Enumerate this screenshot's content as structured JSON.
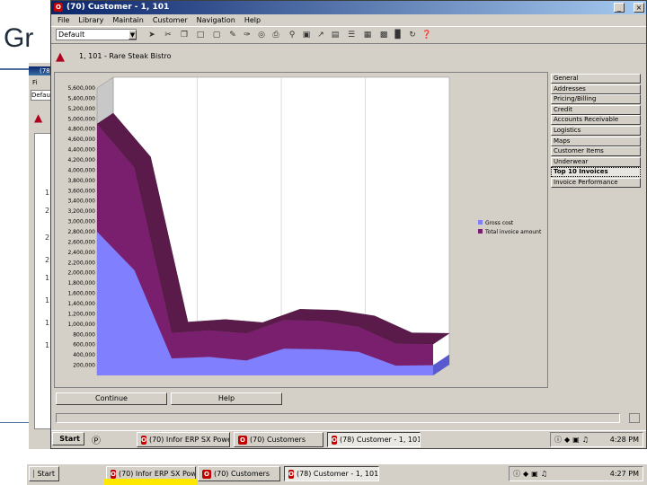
{
  "slide": {
    "title_fragment": "Gr"
  },
  "window": {
    "title": "(70) Customer - 1, 101",
    "icon": "app-red-square-icon",
    "menu": [
      "File",
      "Library",
      "Maintain",
      "Customer",
      "Navigation",
      "Help"
    ],
    "combo_value": "Default",
    "toolbar_icons": [
      "pointer-icon",
      "cut-icon",
      "copy-icon",
      "paste-icon",
      "new-icon",
      "edit-icon",
      "pen-icon",
      "preview-icon",
      "print-icon",
      "find-icon",
      "image-icon",
      "export-icon",
      "chart-icon",
      "tree-icon",
      "table-icon",
      "note-icon",
      "book-icon",
      "refresh-icon"
    ],
    "record_text": "1, 101 - Rare Steak Bistro"
  },
  "tabs": [
    {
      "label": "General",
      "selected": false
    },
    {
      "label": "Addresses",
      "selected": false
    },
    {
      "label": "Pricing/Billing",
      "selected": false
    },
    {
      "label": "Credit",
      "selected": false
    },
    {
      "label": "Accounts Receivable",
      "selected": false
    },
    {
      "label": "Logistics",
      "selected": false
    },
    {
      "label": "Maps",
      "selected": false
    },
    {
      "label": "Customer Items",
      "selected": false
    },
    {
      "label": "Underwear",
      "selected": false
    },
    {
      "label": "Top 10 Invoices",
      "selected": true
    },
    {
      "label": "Invoice Performance",
      "selected": false
    }
  ],
  "buttons": {
    "continue": "Continue",
    "help": "Help"
  },
  "chart_data": {
    "type": "area",
    "legend_position": "right",
    "grid": true,
    "ylim": [
      0,
      5600000
    ],
    "y_ticks": [
      "200,000",
      "400,000",
      "600,000",
      "800,000",
      "1,000,000",
      "1,200,000",
      "1,400,000",
      "1,600,000",
      "1,800,000",
      "2,000,000",
      "2,200,000",
      "2,400,000",
      "2,600,000",
      "2,800,000",
      "3,000,000",
      "3,200,000",
      "3,400,000",
      "3,600,000",
      "3,800,000",
      "4,000,000",
      "4,200,000",
      "4,400,000",
      "4,600,000",
      "4,800,000",
      "5,000,000",
      "5,200,000",
      "5,400,000",
      "5,600,000"
    ],
    "x": [
      1,
      2,
      3,
      4,
      5,
      6,
      7,
      8,
      9,
      10
    ],
    "series": [
      {
        "name": "Gross cost",
        "color": "#8080ff",
        "values": [
          2800000,
          2050000,
          330000,
          360000,
          290000,
          520000,
          510000,
          460000,
          190000,
          200000
        ]
      },
      {
        "name": "Total invoice amount",
        "color": "#7a1f6e",
        "values": [
          4900000,
          4050000,
          830000,
          880000,
          820000,
          1080000,
          1060000,
          950000,
          620000,
          610000
        ]
      }
    ],
    "top_face_color": "#5a1a4a"
  },
  "inner_taskbar": {
    "start": "Start",
    "items": [
      "(70) Infor ERP SX Power...",
      "(70) Customers",
      "(78) Customer - 1, 101"
    ],
    "clock": "4:28 PM"
  },
  "outer_taskbar": {
    "start": "Start",
    "items": [
      "(70) Infor ERP SX Power...",
      "(70) Customers",
      "(78) Customer - 1, 101"
    ],
    "clock": "4:27 PM"
  },
  "background_window": {
    "title_fragment": "(78",
    "menu_fragment": "Fi",
    "combo_fragment": "Defau",
    "digits": [
      "1",
      "2",
      "2",
      "2",
      "1",
      "1",
      "1",
      "1"
    ]
  }
}
